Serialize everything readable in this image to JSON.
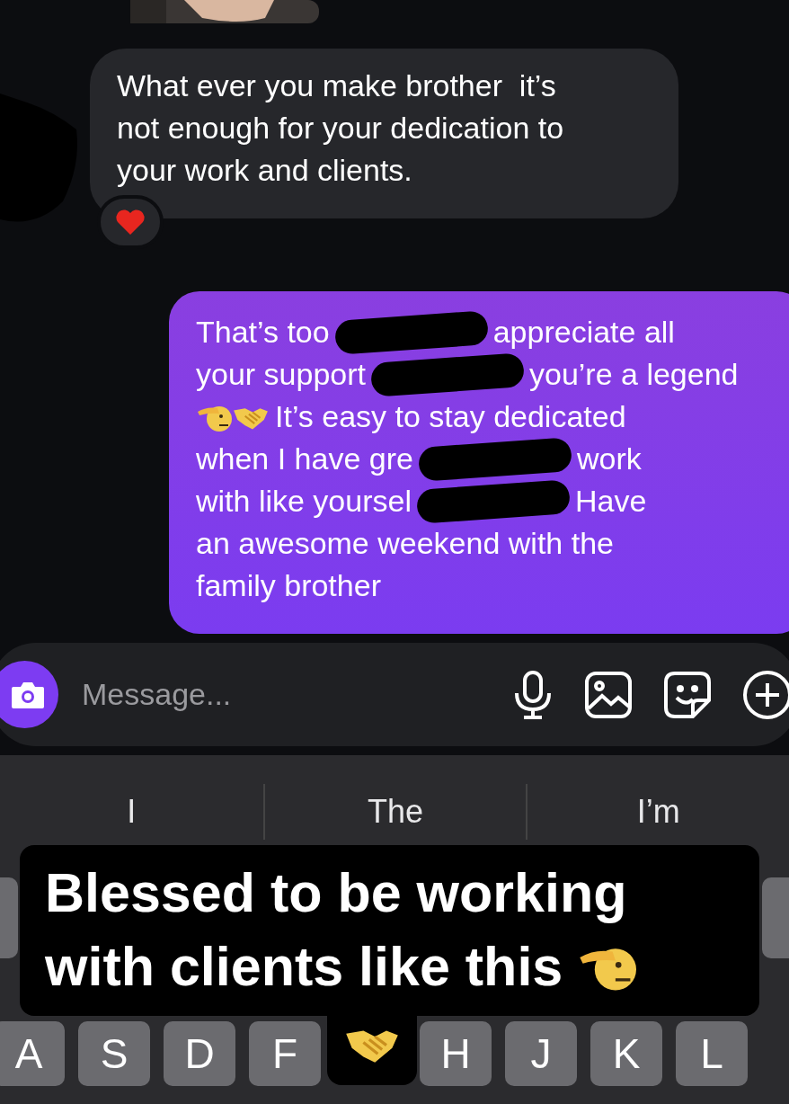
{
  "received_message": {
    "lines": [
      "What ever you make brother  it’s",
      "not enough for your dedication to",
      "your work and clients."
    ],
    "reaction": {
      "kind": "heart"
    }
  },
  "sent_message": {
    "lines": [
      {
        "parts": [
          {
            "kind": "text",
            "text": "That’s too"
          },
          {
            "kind": "redaction"
          },
          {
            "kind": "text",
            "text": "appreciate all"
          }
        ]
      },
      {
        "parts": [
          {
            "kind": "text",
            "text": "your support"
          },
          {
            "kind": "redaction"
          },
          {
            "kind": "text",
            "text": "you’re a legend"
          }
        ]
      },
      {
        "parts": [
          {
            "kind": "salute_emoji"
          },
          {
            "kind": "handshake_emoji"
          },
          {
            "kind": "text",
            "text": "It’s easy to stay dedicated"
          }
        ]
      },
      {
        "parts": [
          {
            "kind": "text",
            "text": "when I have gre"
          },
          {
            "kind": "redaction"
          },
          {
            "kind": "text",
            "text": "work"
          }
        ]
      },
      {
        "parts": [
          {
            "kind": "text",
            "text": "with like yoursel"
          },
          {
            "kind": "redaction"
          },
          {
            "kind": "text",
            "text": "Have"
          }
        ]
      },
      {
        "parts": [
          {
            "kind": "text",
            "text": "an awesome weekend with the"
          }
        ]
      },
      {
        "parts": [
          {
            "kind": "text",
            "text": "family brother"
          }
        ]
      }
    ]
  },
  "composer": {
    "placeholder": "Message..."
  },
  "keyboard": {
    "suggestions": [
      "I",
      "The",
      "I’m"
    ],
    "home_row": [
      {
        "kind": "letter",
        "label": "A"
      },
      {
        "kind": "letter",
        "label": "S"
      },
      {
        "kind": "letter",
        "label": "D"
      },
      {
        "kind": "letter",
        "label": "F"
      },
      {
        "kind": "covered"
      },
      {
        "kind": "letter",
        "label": "H"
      },
      {
        "kind": "letter",
        "label": "J"
      },
      {
        "kind": "letter",
        "label": "K"
      },
      {
        "kind": "letter",
        "label": "L"
      }
    ]
  },
  "caption": {
    "lines": [
      "Blessed to be working",
      "with clients like this"
    ]
  }
}
